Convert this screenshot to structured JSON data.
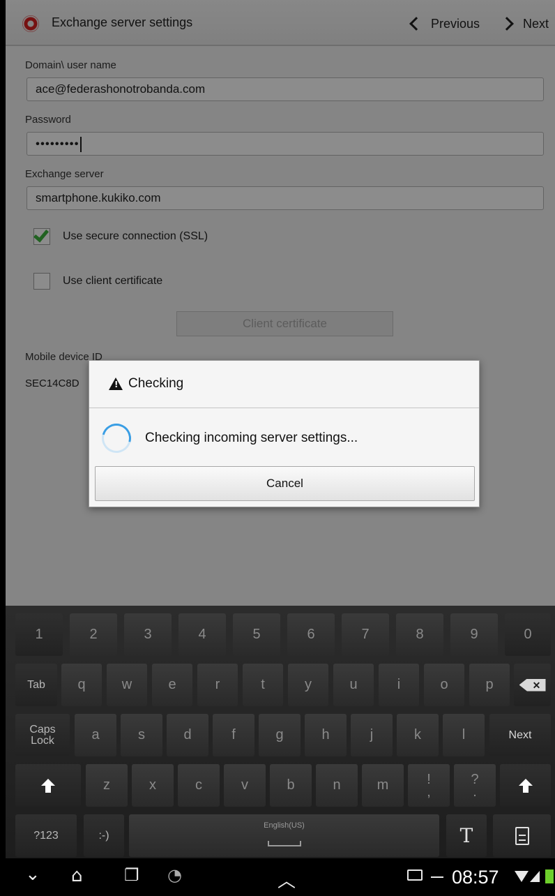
{
  "action_bar": {
    "title": "Exchange server settings",
    "previous_label": "Previous",
    "next_label": "Next"
  },
  "form": {
    "username_label": "Domain\\ user name",
    "username_value": "ace@federashonotrobanda.com",
    "password_label": "Password",
    "password_value": "•••••••••",
    "server_label": "Exchange server",
    "server_value": "smartphone.kukiko.com",
    "ssl_label": "Use secure connection (SSL)",
    "ssl_checked": true,
    "client_cert_label": "Use client certificate",
    "client_cert_checked": false,
    "client_cert_button": "Client certificate",
    "device_id_label": "Mobile device ID",
    "device_id_value": "SEC14C8D"
  },
  "dialog": {
    "title": "Checking",
    "message": "Checking incoming server settings...",
    "cancel_label": "Cancel"
  },
  "keyboard": {
    "row1": [
      "1",
      "2",
      "3",
      "4",
      "5",
      "6",
      "7",
      "8",
      "9",
      "0"
    ],
    "row2": [
      "q",
      "w",
      "e",
      "r",
      "t",
      "y",
      "u",
      "i",
      "o",
      "p"
    ],
    "row3": [
      "a",
      "s",
      "d",
      "f",
      "g",
      "h",
      "j",
      "k",
      "l"
    ],
    "row4": [
      "z",
      "x",
      "c",
      "v",
      "b",
      "n",
      "m"
    ],
    "tab_label": "Tab",
    "caps_label_1": "Caps",
    "caps_label_2": "Lock",
    "next_label": "Next",
    "sym_label": "?123",
    "emoticon_label": ":-)",
    "language_label": "English(US)",
    "exclaim_top": "!",
    "exclaim_bottom": ",",
    "question_top": "?",
    "question_bottom": ".",
    "handwriting_label": "T"
  },
  "status_bar": {
    "time": "08:57"
  },
  "colors": {
    "accent_checkbox": "#3db33d",
    "spinner": "#3a9ee4",
    "battery": "#6ecf2c"
  }
}
